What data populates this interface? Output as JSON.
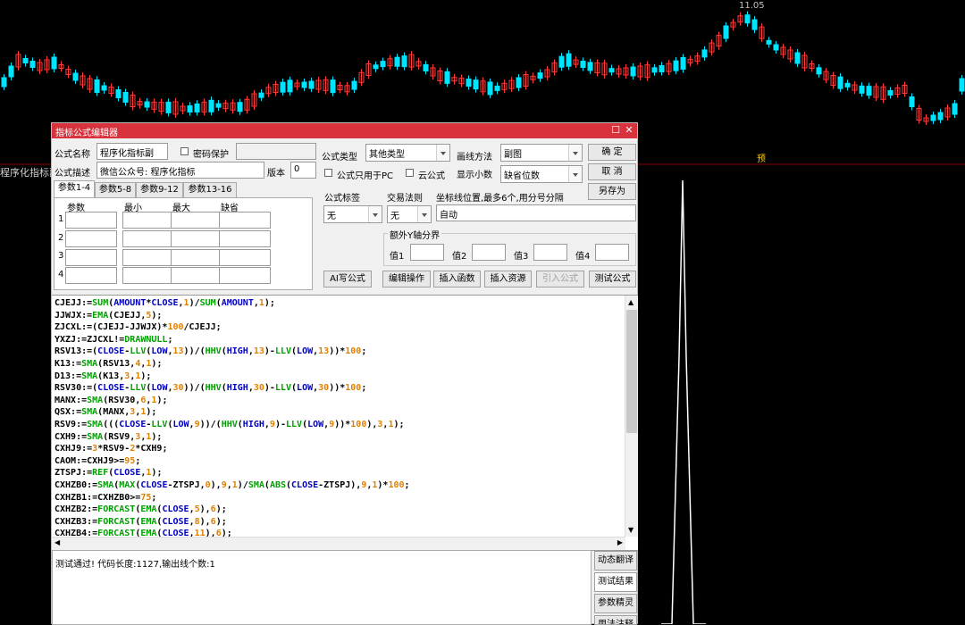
{
  "chart": {
    "price_label": "11.05",
    "marker": "预",
    "panel_label": "程序化指标副",
    "colors": {
      "up": "#ff3c3c",
      "down": "#00e5ff",
      "bg": "#000000",
      "line": "#ffffff"
    },
    "candles": [
      [
        0,
        0,
        -1
      ],
      [
        1,
        1,
        -1
      ],
      [
        2,
        1,
        1
      ],
      [
        3,
        1,
        1
      ],
      [
        4,
        0,
        -1
      ],
      [
        5,
        0,
        -1
      ],
      [
        6,
        0,
        1
      ],
      [
        7,
        1,
        -1
      ],
      [
        8,
        0,
        1
      ],
      [
        9,
        1,
        1
      ],
      [
        10,
        1,
        -1
      ],
      [
        11,
        0,
        1
      ],
      [
        12,
        0,
        -1
      ],
      [
        13,
        1,
        1
      ],
      [
        14,
        0,
        1
      ],
      [
        15,
        1,
        -1
      ],
      [
        16,
        0,
        1
      ],
      [
        17,
        0,
        -1
      ],
      [
        18,
        1,
        1
      ],
      [
        19,
        0,
        1
      ]
    ]
  },
  "dialog": {
    "title": "指标公式编辑器",
    "name_label": "公式名称",
    "name_value": "程序化指标副",
    "password_label": "密码保护",
    "desc_label": "公式描述",
    "desc_value": "微信公众号: 程序化指标",
    "version_label": "版本",
    "version_value": "0",
    "type_label": "公式类型",
    "type_value": "其他类型",
    "draw_label": "画线方法",
    "draw_value": "副图",
    "ok": "确  定",
    "cancel": "取  消",
    "saveas": "另存为",
    "pc_only": "公式只用于PC",
    "cloud": "云公式",
    "decimals_label": "显示小数",
    "decimals_value": "缺省位数",
    "tabs": [
      "参数1-4",
      "参数5-8",
      "参数9-12",
      "参数13-16"
    ],
    "param_headers": [
      "参数",
      "最小",
      "最大",
      "缺省"
    ],
    "param_rows": [
      "1",
      "2",
      "3",
      "4"
    ],
    "tag_label": "公式标签",
    "tag_value": "无",
    "trade_label": "交易法则",
    "trade_value": "无",
    "axis_label": "坐标线位置,最多6个,用分号分隔",
    "axis_value": "自动",
    "extra_y_label": "额外Y轴分界",
    "values": [
      "值1",
      "值2",
      "值3",
      "值4"
    ],
    "buttons": [
      "AI写公式",
      "编辑操作",
      "插入函数",
      "插入资源",
      "引入公式",
      "测试公式"
    ],
    "result_text": "测试通过! 代码长度:1127,输出线个数:1",
    "side_buttons": [
      "动态翻译",
      "测试结果",
      "参数精灵",
      "用法注释"
    ]
  },
  "code_lines": [
    [
      [
        "CJEJJ:=",
        ""
      ],
      [
        "SUM",
        "g"
      ],
      [
        "(",
        ""
      ],
      [
        "AMOUNT",
        "b"
      ],
      [
        "*",
        ""
      ],
      [
        "CLOSE",
        "b"
      ],
      [
        ",",
        ""
      ],
      [
        "1",
        "o"
      ],
      [
        ")/",
        ""
      ],
      [
        "SUM",
        "g"
      ],
      [
        "(",
        ""
      ],
      [
        "AMOUNT",
        "b"
      ],
      [
        ",",
        ""
      ],
      [
        "1",
        "o"
      ],
      [
        ");",
        ""
      ]
    ],
    [
      [
        "JJWJX:=",
        ""
      ],
      [
        "EMA",
        "g"
      ],
      [
        "(CJEJJ,",
        ""
      ],
      [
        "5",
        "o"
      ],
      [
        ");",
        ""
      ]
    ],
    [
      [
        "ZJCXL:=(CJEJJ-JJWJX)*",
        ""
      ],
      [
        "100",
        "o"
      ],
      [
        "/CJEJJ;",
        ""
      ]
    ],
    [
      [
        "YXZJ:=ZJCXL!=",
        ""
      ],
      [
        "DRAWNULL",
        "g"
      ],
      [
        ";",
        ""
      ]
    ],
    [
      [
        "RSV13:=(",
        ""
      ],
      [
        "CLOSE",
        "b"
      ],
      [
        "-",
        ""
      ],
      [
        "LLV",
        "g"
      ],
      [
        "(",
        ""
      ],
      [
        "LOW",
        "b"
      ],
      [
        ",",
        ""
      ],
      [
        "13",
        "o"
      ],
      [
        "))/(",
        ""
      ],
      [
        "HHV",
        "g"
      ],
      [
        "(",
        ""
      ],
      [
        "HIGH",
        "b"
      ],
      [
        ",",
        ""
      ],
      [
        "13",
        "o"
      ],
      [
        ")-",
        ""
      ],
      [
        "LLV",
        "g"
      ],
      [
        "(",
        ""
      ],
      [
        "LOW",
        "b"
      ],
      [
        ",",
        ""
      ],
      [
        "13",
        "o"
      ],
      [
        "))*",
        ""
      ],
      [
        "100",
        "o"
      ],
      [
        ";",
        ""
      ]
    ],
    [
      [
        "K13:=",
        ""
      ],
      [
        "SMA",
        "g"
      ],
      [
        "(RSV13,",
        ""
      ],
      [
        "4",
        "o"
      ],
      [
        ",",
        ""
      ],
      [
        "1",
        "o"
      ],
      [
        ");",
        ""
      ]
    ],
    [
      [
        "D13:=",
        ""
      ],
      [
        "SMA",
        "g"
      ],
      [
        "(K13,",
        ""
      ],
      [
        "3",
        "o"
      ],
      [
        ",",
        ""
      ],
      [
        "1",
        "o"
      ],
      [
        ");",
        ""
      ]
    ],
    [
      [
        "RSV30:=(",
        ""
      ],
      [
        "CLOSE",
        "b"
      ],
      [
        "-",
        ""
      ],
      [
        "LLV",
        "g"
      ],
      [
        "(",
        ""
      ],
      [
        "LOW",
        "b"
      ],
      [
        ",",
        ""
      ],
      [
        "30",
        "o"
      ],
      [
        "))/(",
        ""
      ],
      [
        "HHV",
        "g"
      ],
      [
        "(",
        ""
      ],
      [
        "HIGH",
        "b"
      ],
      [
        ",",
        ""
      ],
      [
        "30",
        "o"
      ],
      [
        ")-",
        ""
      ],
      [
        "LLV",
        "g"
      ],
      [
        "(",
        ""
      ],
      [
        "LOW",
        "b"
      ],
      [
        ",",
        ""
      ],
      [
        "30",
        "o"
      ],
      [
        "))*",
        ""
      ],
      [
        "100",
        "o"
      ],
      [
        ";",
        ""
      ]
    ],
    [
      [
        "MANX:=",
        ""
      ],
      [
        "SMA",
        "g"
      ],
      [
        "(RSV30,",
        ""
      ],
      [
        "6",
        "o"
      ],
      [
        ",",
        ""
      ],
      [
        "1",
        "o"
      ],
      [
        ");",
        ""
      ]
    ],
    [
      [
        "QSX:=",
        ""
      ],
      [
        "SMA",
        "g"
      ],
      [
        "(MANX,",
        ""
      ],
      [
        "3",
        "o"
      ],
      [
        ",",
        ""
      ],
      [
        "1",
        "o"
      ],
      [
        ");",
        ""
      ]
    ],
    [
      [
        "RSV9:=",
        ""
      ],
      [
        "SMA",
        "g"
      ],
      [
        "(((",
        ""
      ],
      [
        "CLOSE",
        "b"
      ],
      [
        "-",
        ""
      ],
      [
        "LLV",
        "g"
      ],
      [
        "(",
        ""
      ],
      [
        "LOW",
        "b"
      ],
      [
        ",",
        ""
      ],
      [
        "9",
        "o"
      ],
      [
        "))/(",
        ""
      ],
      [
        "HHV",
        "g"
      ],
      [
        "(",
        ""
      ],
      [
        "HIGH",
        "b"
      ],
      [
        ",",
        ""
      ],
      [
        "9",
        "o"
      ],
      [
        ")-",
        ""
      ],
      [
        "LLV",
        "g"
      ],
      [
        "(",
        ""
      ],
      [
        "LOW",
        "b"
      ],
      [
        ",",
        ""
      ],
      [
        "9",
        "o"
      ],
      [
        "))*",
        ""
      ],
      [
        "100",
        "o"
      ],
      [
        "),",
        ""
      ],
      [
        "3",
        "o"
      ],
      [
        ",",
        ""
      ],
      [
        "1",
        "o"
      ],
      [
        ");",
        ""
      ]
    ],
    [
      [
        "CXH9:=",
        ""
      ],
      [
        "SMA",
        "g"
      ],
      [
        "(RSV9,",
        ""
      ],
      [
        "3",
        "o"
      ],
      [
        ",",
        ""
      ],
      [
        "1",
        "o"
      ],
      [
        ");",
        ""
      ]
    ],
    [
      [
        "CXHJ9:=",
        ""
      ],
      [
        "3",
        "o"
      ],
      [
        "*RSV9-",
        ""
      ],
      [
        "2",
        "o"
      ],
      [
        "*CXH9;",
        ""
      ]
    ],
    [
      [
        "CAOM:=CXHJ9>=",
        ""
      ],
      [
        "95",
        "o"
      ],
      [
        ";",
        ""
      ]
    ],
    [
      [
        "ZTSPJ:=",
        ""
      ],
      [
        "REF",
        "g"
      ],
      [
        "(",
        ""
      ],
      [
        "CLOSE",
        "b"
      ],
      [
        ",",
        ""
      ],
      [
        "1",
        "o"
      ],
      [
        ");",
        ""
      ]
    ],
    [
      [
        "CXHZB0:=",
        ""
      ],
      [
        "SMA",
        "g"
      ],
      [
        "(",
        ""
      ],
      [
        "MAX",
        "g"
      ],
      [
        "(",
        ""
      ],
      [
        "CLOSE",
        "b"
      ],
      [
        "-ZTSPJ,",
        ""
      ],
      [
        "0",
        "o"
      ],
      [
        "),",
        ""
      ],
      [
        "9",
        "o"
      ],
      [
        ",",
        ""
      ],
      [
        "1",
        "o"
      ],
      [
        ")/",
        ""
      ],
      [
        "SMA",
        "g"
      ],
      [
        "(",
        ""
      ],
      [
        "ABS",
        "g"
      ],
      [
        "(",
        ""
      ],
      [
        "CLOSE",
        "b"
      ],
      [
        "-ZTSPJ),",
        ""
      ],
      [
        "9",
        "o"
      ],
      [
        ",",
        ""
      ],
      [
        "1",
        "o"
      ],
      [
        ")*",
        ""
      ],
      [
        "100",
        "o"
      ],
      [
        ";",
        ""
      ]
    ],
    [
      [
        "CXHZB1:=CXHZB0>=",
        ""
      ],
      [
        "75",
        "o"
      ],
      [
        ";",
        ""
      ]
    ],
    [
      [
        "CXHZB2:=",
        ""
      ],
      [
        "FORCAST",
        "g"
      ],
      [
        "(",
        ""
      ],
      [
        "EMA",
        "g"
      ],
      [
        "(",
        ""
      ],
      [
        "CLOSE",
        "b"
      ],
      [
        ",",
        ""
      ],
      [
        "5",
        "o"
      ],
      [
        "),",
        ""
      ],
      [
        "6",
        "o"
      ],
      [
        ");",
        ""
      ]
    ],
    [
      [
        "CXHZB3:=",
        ""
      ],
      [
        "FORCAST",
        "g"
      ],
      [
        "(",
        ""
      ],
      [
        "EMA",
        "g"
      ],
      [
        "(",
        ""
      ],
      [
        "CLOSE",
        "b"
      ],
      [
        ",",
        ""
      ],
      [
        "8",
        "o"
      ],
      [
        "),",
        ""
      ],
      [
        "6",
        "o"
      ],
      [
        ");",
        ""
      ]
    ],
    [
      [
        "CXHZB4:=",
        ""
      ],
      [
        "FORCAST",
        "g"
      ],
      [
        "(",
        ""
      ],
      [
        "EMA",
        "g"
      ],
      [
        "(",
        ""
      ],
      [
        "CLOSE",
        "b"
      ],
      [
        ",",
        ""
      ],
      [
        "11",
        "o"
      ],
      [
        "),",
        ""
      ],
      [
        "6",
        "o"
      ],
      [
        ");",
        ""
      ]
    ]
  ]
}
